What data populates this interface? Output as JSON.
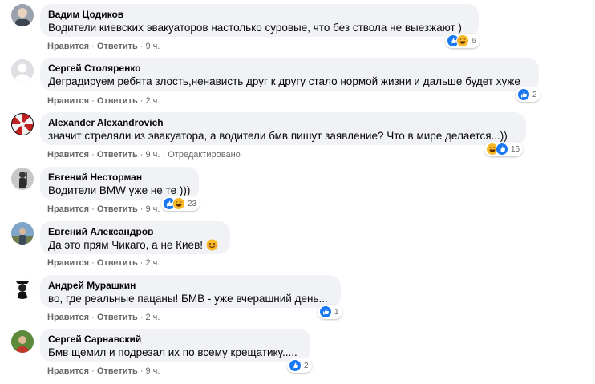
{
  "comments": [
    {
      "author": "Вадим Цодиков",
      "text": "Водители киевских эвакуаторов настолько суровые, что без ствола не выезжают )",
      "like": "Нравится",
      "reply": "Ответить",
      "time": "9 ч.",
      "reaction_count": "6"
    },
    {
      "author": "Сергей Столяренко",
      "text": "Деградируем ребята злость,ненависть друг к другу стало нормой жизни и дальше будет хуже",
      "like": "Нравится",
      "reply": "Ответить",
      "time": "2 ч.",
      "reaction_count": "2"
    },
    {
      "author": "Alexander Alexandrovich",
      "text": "значит стреляли из эвакуатора, а водители бмв пишут заявление? Что в мире делается...))",
      "like": "Нравится",
      "reply": "Ответить",
      "time": "9 ч.",
      "edited": "Отредактировано",
      "reaction_count": "15"
    },
    {
      "author": "Евгений Несторман",
      "text": "Водители BMW уже не те )))",
      "like": "Нравится",
      "reply": "Ответить",
      "time": "9 ч.",
      "reaction_count": "23"
    },
    {
      "author": "Евгений Александров",
      "text": "Да это прям Чикаго, а не Киев!",
      "like": "Нравится",
      "reply": "Ответить",
      "time": "2 ч."
    },
    {
      "author": "Андрей Мурашкин",
      "text": "во, где реальные пацаны! БМВ - уже вчерашний день...",
      "like": "Нравится",
      "reply": "Ответить",
      "time": "2 ч.",
      "reaction_count": "1"
    },
    {
      "author": "Сергей Сарнавский",
      "text": "Бмв щемил и подрезал их по всему крещатику.....",
      "like": "Нравится",
      "reply": "Ответить",
      "time": "9 ч.",
      "reaction_count": "2"
    }
  ],
  "colors": {
    "bubble": "#f0f2f5",
    "like_blue": "#1877f2",
    "haha_yellow": "#f7b928",
    "meta_text": "#65676b"
  }
}
